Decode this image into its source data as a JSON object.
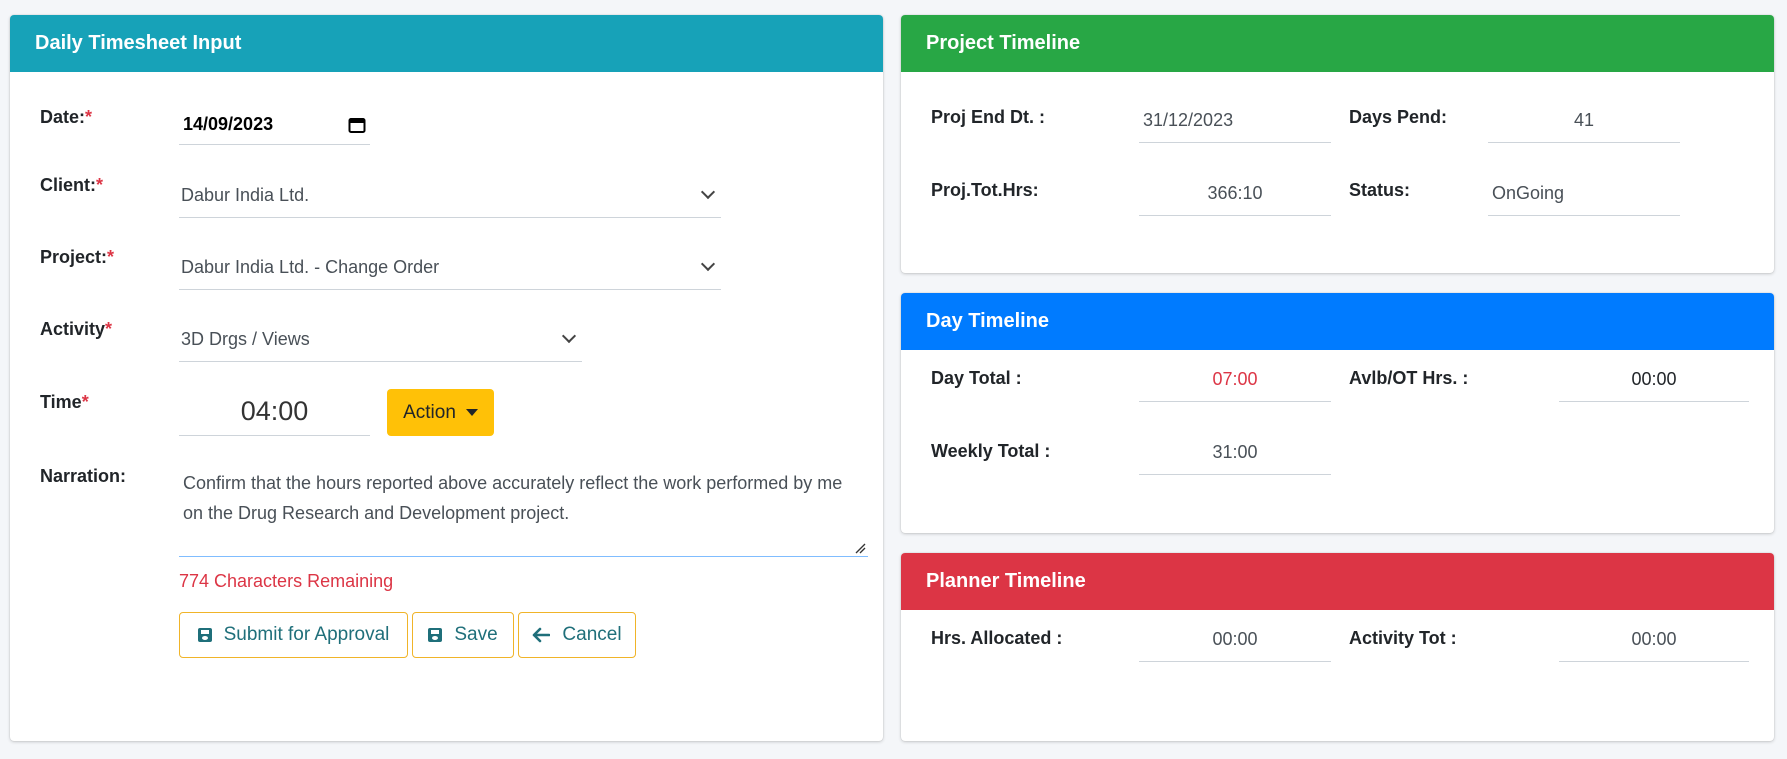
{
  "timesheet": {
    "title": "Daily Timesheet Input",
    "date_label": "Date:",
    "date_value": "14/09/2023",
    "client_label": "Client:",
    "client_value": "Dabur India Ltd.",
    "project_label": "Project:",
    "project_value": "Dabur India Ltd. - Change Order",
    "activity_label": "Activity",
    "activity_value": "3D Drgs / Views",
    "time_label": "Time",
    "time_value": "04:00",
    "action_label": "Action",
    "narration_label": "Narration:",
    "narration_value": "Confirm that the hours reported above accurately reflect the work performed by me on the Drug Research and Development project.",
    "chars_remaining": "774 Characters Remaining",
    "required_mark": "*",
    "submit_label": "Submit for Approval",
    "save_label": "Save",
    "cancel_label": "Cancel"
  },
  "project_timeline": {
    "title": "Project Timeline",
    "end_label": "Proj End Dt. :",
    "end_value": "31/12/2023",
    "days_label": "Days Pend:",
    "days_value": "41",
    "tot_label": "Proj.Tot.Hrs:",
    "tot_value": "366:10",
    "status_label": "Status:",
    "status_value": "OnGoing"
  },
  "day_timeline": {
    "title": "Day Timeline",
    "day_total_label": "Day Total :",
    "day_total_value": "07:00",
    "avlb_label": "Avlb/OT Hrs. :",
    "avlb_value": "00:00",
    "weekly_label": "Weekly Total :",
    "weekly_value": "31:00"
  },
  "planner_timeline": {
    "title": "Planner Timeline",
    "alloc_label": "Hrs. Allocated :",
    "alloc_value": "00:00",
    "activity_tot_label": "Activity Tot :",
    "activity_tot_value": "00:00"
  },
  "colors": {
    "teal": "#17a2b8",
    "green": "#28a745",
    "blue": "#007bff",
    "red": "#dc3545",
    "yellow": "#ffc107"
  }
}
